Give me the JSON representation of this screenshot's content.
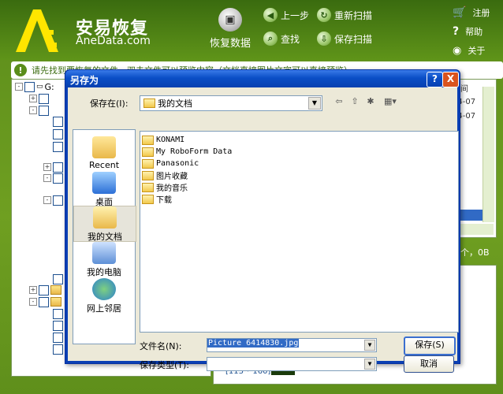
{
  "app": {
    "logo_title": "安易恢复",
    "logo_sub": "AneData.com",
    "toolbar": {
      "recover": "恢复数据",
      "prev": "上一步",
      "rescan": "重新扫描",
      "find": "查找",
      "save_scan": "保存扫描"
    },
    "links": {
      "register": "注册",
      "help": "帮助",
      "about": "关于"
    },
    "notice": "请先找到要恢复的文件，双击文件可以预览内容（文档直接图片文字可以直接预览）",
    "tree_root": "G:",
    "right_header": "时间",
    "right_dates": [
      "04-07",
      "04-07"
    ],
    "status_text": "个，0B",
    "thumb_caption": "[113 * 160]"
  },
  "dialog": {
    "title": "另存为",
    "help_btn": "?",
    "close_btn": "X",
    "save_in_label": "保存在(I):",
    "save_in_value": "我的文档",
    "places": [
      "Recent",
      "桌面",
      "我的文档",
      "我的电脑",
      "网上邻居"
    ],
    "files": [
      "KONAMI",
      "My RoboForm Data",
      "Panasonic",
      "图片收藏",
      "我的音乐",
      "下载"
    ],
    "filename_label": "文件名(N):",
    "filename_value": "Picture 6414830.jpg",
    "filetype_label": "保存类型(T):",
    "filetype_value": "",
    "save_button": "保存(S)",
    "cancel_button": "取消"
  },
  "colors": {
    "accent": "#5c8d1b",
    "dialog_blue": "#0a4ec6"
  }
}
